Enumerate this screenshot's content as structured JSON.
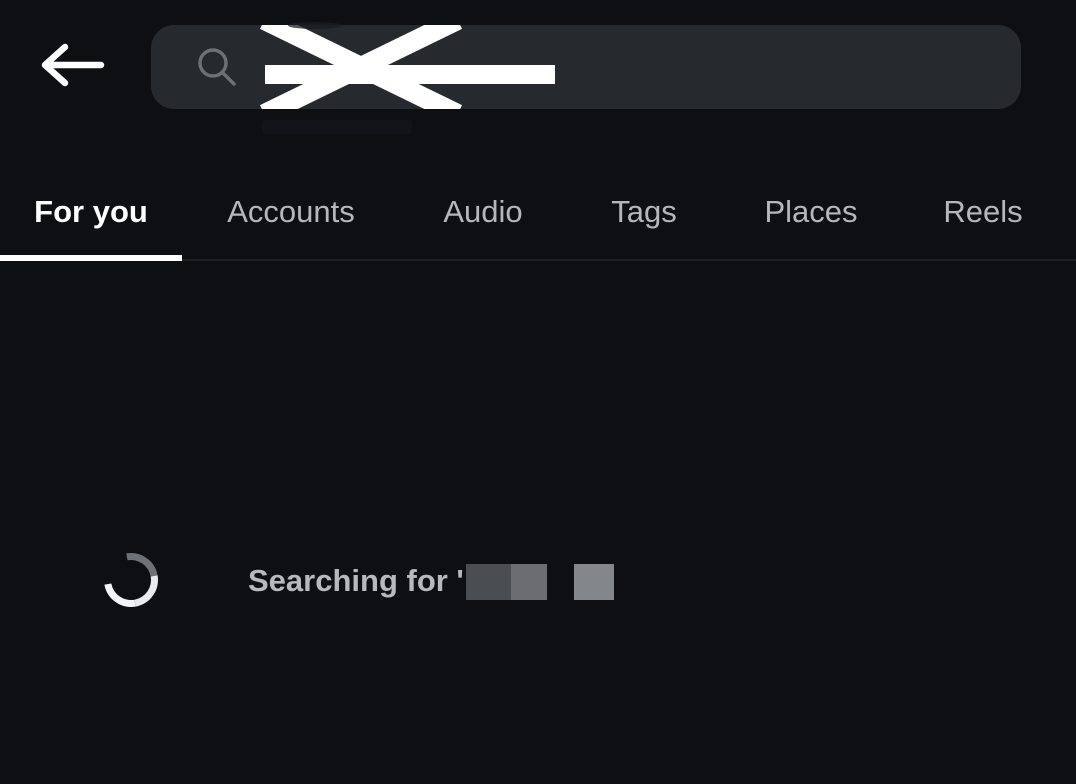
{
  "app": {
    "name": "instagram-search",
    "background_color": "#0d0f13"
  },
  "header": {
    "back_icon": "back-arrow-icon",
    "search": {
      "icon": "search-icon",
      "value": "",
      "placeholder": "",
      "redacted": true,
      "redaction_style": "white-x-strikethrough",
      "background_color": "#262a2f"
    }
  },
  "tabs": {
    "active_index": 0,
    "indicator_color": "#ffffff",
    "items": [
      {
        "label": "For you",
        "active": true
      },
      {
        "label": "Accounts",
        "active": false
      },
      {
        "label": "Audio",
        "active": false
      },
      {
        "label": "Tags",
        "active": false
      },
      {
        "label": "Places",
        "active": false
      },
      {
        "label": "Reels",
        "active": false
      }
    ]
  },
  "status": {
    "spinner": "loading-spinner-icon",
    "text": "Searching for '",
    "text_color": "#b6babf",
    "censor_blocks": [
      {
        "color": "#4a4e53"
      },
      {
        "color": "#6b6d70"
      },
      {
        "color": "#83868a"
      }
    ]
  }
}
